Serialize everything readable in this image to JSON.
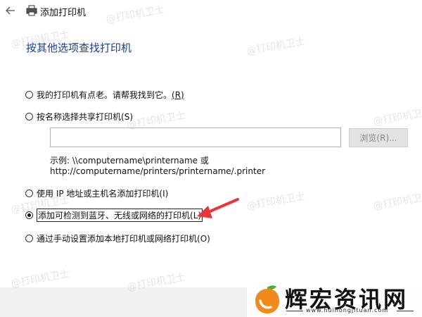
{
  "window": {
    "title": "添加打印机"
  },
  "page": {
    "heading": "按其他选项查找打印机"
  },
  "options": [
    {
      "label": "我的打印机有点老。请帮我找到它。",
      "key": "(R)",
      "checked": false
    },
    {
      "label": "按名称选择共享打印机",
      "key": "(S)",
      "checked": false
    },
    {
      "label": "使用 IP 地址或主机名添加打印机",
      "key": "(I)",
      "checked": false
    },
    {
      "label": "添加可检测到蓝牙、无线或网络的打印机",
      "key": "(L)",
      "checked": true
    },
    {
      "label": "通过手动设置添加本地打印机或网络打印机",
      "key": "(O)",
      "checked": false
    }
  ],
  "share_input": {
    "value": ""
  },
  "browse_button": {
    "label": "浏览(R)..."
  },
  "example": {
    "line1": "示例: \\\\computername\\printername 或",
    "line2": "http://computername/printers/printername/.printer"
  },
  "watermark": {
    "text": "@打印机卫士"
  },
  "branding": {
    "name": "辉宏资讯网",
    "url": "www.huihongjituan.com"
  },
  "colors": {
    "heading": "#1a3f8e",
    "arrow": "#e8373a",
    "footer": "#f0f0f0"
  }
}
